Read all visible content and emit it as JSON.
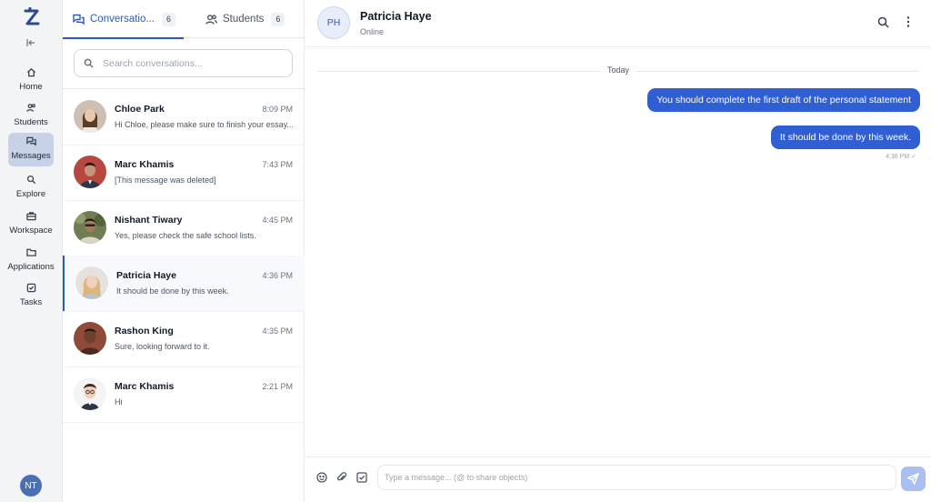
{
  "colors": {
    "accent": "#2b5bb8",
    "bubble": "#2f5fd3",
    "active_nav": "#c7d2e8"
  },
  "rail": {
    "logo_icon": "z-logo",
    "collapse_icon": "collapse-left-icon",
    "items": [
      {
        "label": "Home",
        "icon": "home-icon"
      },
      {
        "label": "Students",
        "icon": "students-icon"
      },
      {
        "label": "Messages",
        "icon": "messages-icon",
        "active": true
      },
      {
        "label": "Explore",
        "icon": "search-icon"
      },
      {
        "label": "Workspace",
        "icon": "briefcase-icon"
      },
      {
        "label": "Applications",
        "icon": "folder-icon"
      },
      {
        "label": "Tasks",
        "icon": "checkbox-icon"
      }
    ],
    "user_initials": "NT"
  },
  "tabs": {
    "conversations": {
      "label": "Conversatio...",
      "count": "6"
    },
    "students": {
      "label": "Students",
      "count": "6"
    }
  },
  "search": {
    "placeholder": "Search conversations..."
  },
  "conversations": [
    {
      "name": "Chloe Park",
      "time": "8:09 PM",
      "preview": "Hi Chloe, please make sure to finish your essay..."
    },
    {
      "name": "Marc Khamis",
      "time": "7:43 PM",
      "preview": "[This message was deleted]"
    },
    {
      "name": "Nishant Tiwary",
      "time": "4:45 PM",
      "preview": "Yes, please check the safe school lists."
    },
    {
      "name": "Patricia Haye",
      "time": "4:36 PM",
      "preview": "It should be done by this week.",
      "active": true
    },
    {
      "name": "Rashon King",
      "time": "4:35 PM",
      "preview": "Sure, looking forward to it."
    },
    {
      "name": "Marc Khamis",
      "time": "2:21 PM",
      "preview": "Hi"
    }
  ],
  "chat": {
    "initials": "PH",
    "name": "Patricia Haye",
    "status": "Online",
    "date_divider": "Today",
    "messages": [
      {
        "text": "You should complete the first draft of the personal statement"
      },
      {
        "text": "It should be done by this week."
      }
    ],
    "last_meta": "4:36 PM ✓",
    "composer_placeholder": "Type a message... (@ to share objects)"
  }
}
